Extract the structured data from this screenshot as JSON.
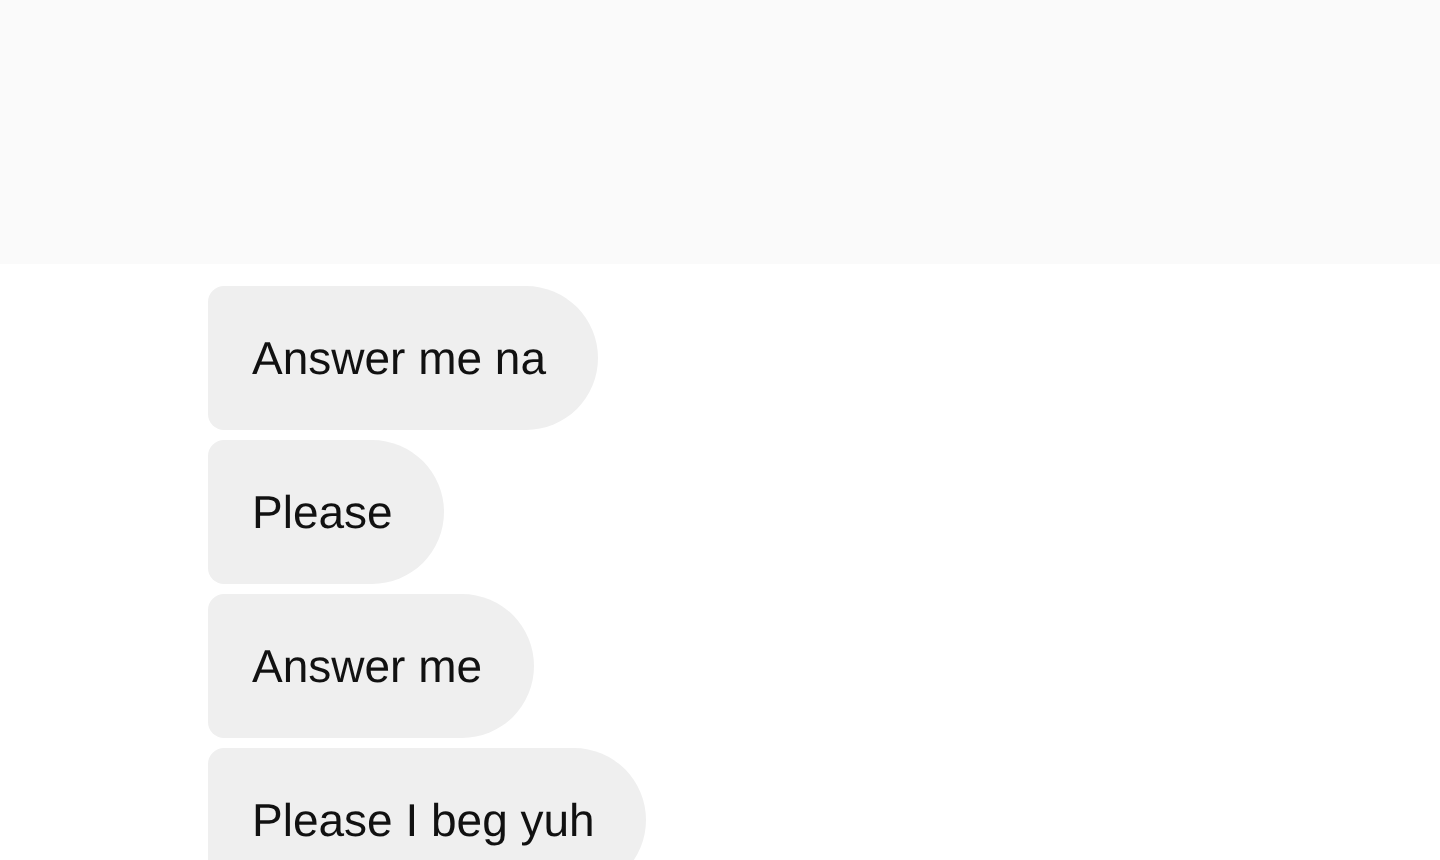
{
  "messages": [
    {
      "text": "Answer me na"
    },
    {
      "text": "Please"
    },
    {
      "text": "Answer me"
    },
    {
      "text": "Please I beg yuh"
    }
  ]
}
